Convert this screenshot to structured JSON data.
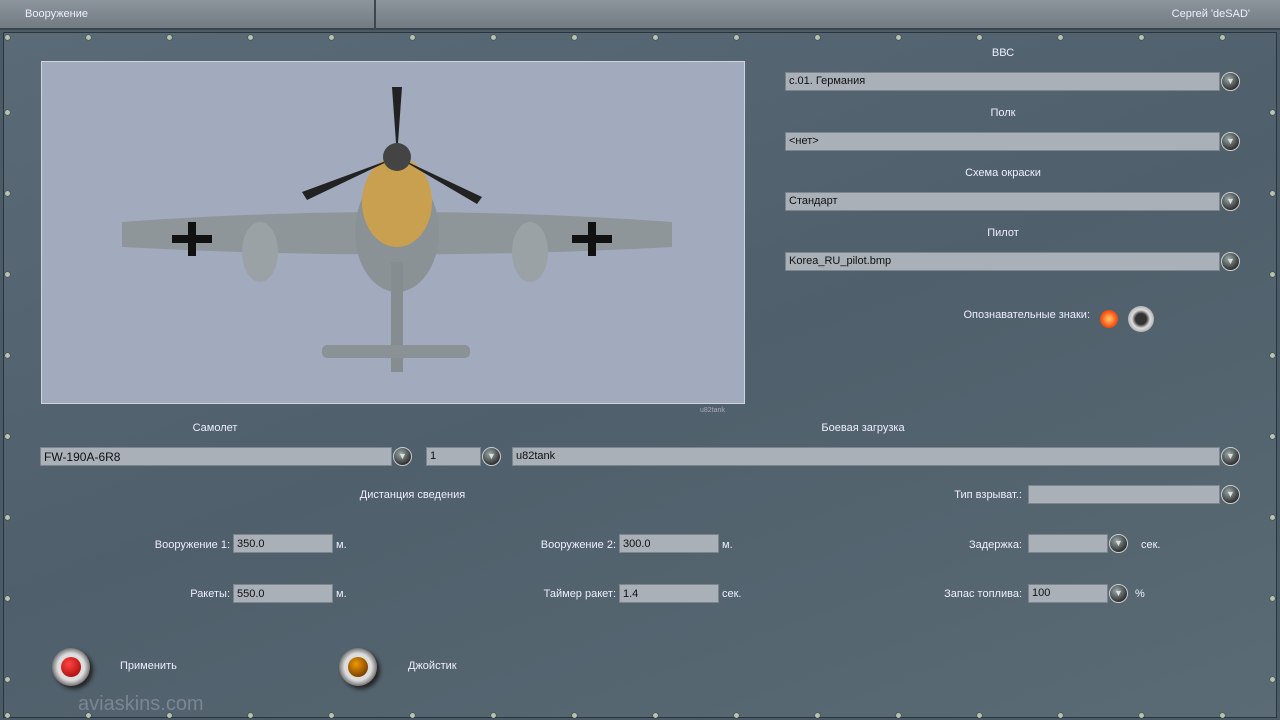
{
  "header": {
    "title": "Вооружение",
    "user": "Сергей 'deSAD'"
  },
  "preview": {
    "caption": "u82tank"
  },
  "right": {
    "air_force": {
      "label": "ВВС",
      "value": "c.01. Германия"
    },
    "regiment": {
      "label": "Полк",
      "value": "<нет>"
    },
    "skin": {
      "label": "Схема окраски",
      "value": "Стандарт"
    },
    "pilot": {
      "label": "Пилот",
      "value": "Korea_RU_pilot.bmp"
    },
    "markings": {
      "label": "Опознавательные знаки:",
      "state": "on"
    }
  },
  "aircraft": {
    "label": "Самолет",
    "value": "FW-190A-6R8",
    "count": "1"
  },
  "loadout": {
    "label": "Боевая загрузка",
    "value": "u82tank"
  },
  "convergence": {
    "label": "Дистанция сведения",
    "weapon1": {
      "label": "Вооружение 1:",
      "value": "350.0",
      "unit": "м."
    },
    "weapon2": {
      "label": "Вооружение 2:",
      "value": "300.0",
      "unit": "м."
    },
    "rockets": {
      "label": "Ракеты:",
      "value": "550.0",
      "unit": "м."
    },
    "rocket_timer": {
      "label": "Таймер ракет:",
      "value": "1.4",
      "unit": "сек."
    }
  },
  "fuse": {
    "label": "Тип взрыват.:",
    "value": ""
  },
  "delay": {
    "label": "Задержка:",
    "value": "",
    "unit": "сек."
  },
  "fuel": {
    "label": "Запас топлива:",
    "value": "100",
    "unit": "%"
  },
  "buttons": {
    "apply": "Применить",
    "joystick": "Джойстик"
  },
  "watermark": "aviaskins.com"
}
